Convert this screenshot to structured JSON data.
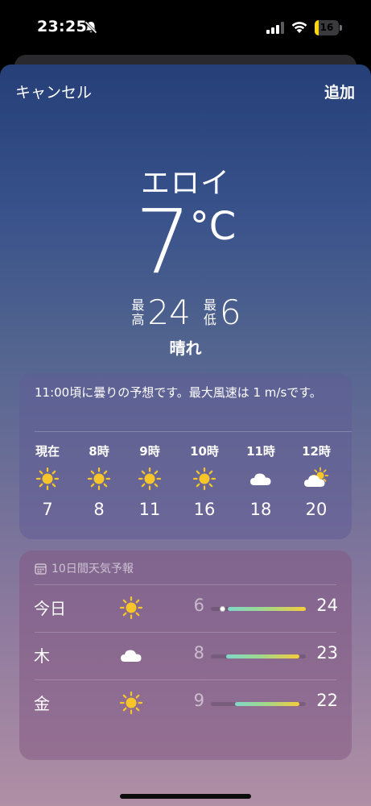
{
  "status_bar": {
    "time": "23:25",
    "battery_level": "16",
    "battery_fraction": 0.16,
    "battery_color": "#ffd60a",
    "icons": [
      "bell-slash-icon",
      "signal-icon",
      "wifi-icon",
      "battery-icon"
    ]
  },
  "sheet": {
    "cancel_label": "キャンセル",
    "add_label": "追加"
  },
  "current": {
    "location": "エロイ",
    "temperature": "7",
    "unit": "°C",
    "high_label": "最高",
    "high_value": "24",
    "low_label": "最低",
    "low_value": "6",
    "condition": "晴れ"
  },
  "hourly": {
    "summary": "11:00頃に曇りの予想です。最大風速は 1 m/sです。",
    "items": [
      {
        "label": "現在",
        "icon": "sun-icon",
        "temp": "7"
      },
      {
        "label": "8時",
        "icon": "sun-icon",
        "temp": "8"
      },
      {
        "label": "9時",
        "icon": "sun-icon",
        "temp": "11"
      },
      {
        "label": "10時",
        "icon": "sun-icon",
        "temp": "16"
      },
      {
        "label": "11時",
        "icon": "cloud-icon",
        "temp": "18"
      },
      {
        "label": "12時",
        "icon": "partly-cloudy-icon",
        "temp": "20"
      }
    ]
  },
  "forecast": {
    "header": "10日間天気予報",
    "days": [
      {
        "day": "今日",
        "icon": "sun-icon",
        "low": "6",
        "high": "24",
        "range_start": 0.18,
        "range_end": 1.0,
        "current_marker": 0.12
      },
      {
        "day": "木",
        "icon": "cloud-icon",
        "low": "8",
        "high": "23",
        "range_start": 0.16,
        "range_end": 0.93
      },
      {
        "day": "金",
        "icon": "sun-icon",
        "low": "9",
        "high": "22",
        "range_start": 0.25,
        "range_end": 0.93
      }
    ]
  },
  "colors": {
    "sun": "#f7c52a",
    "cloud": "#ffffff",
    "background_top": "#263f78",
    "background_bottom": "#b08fa5"
  }
}
